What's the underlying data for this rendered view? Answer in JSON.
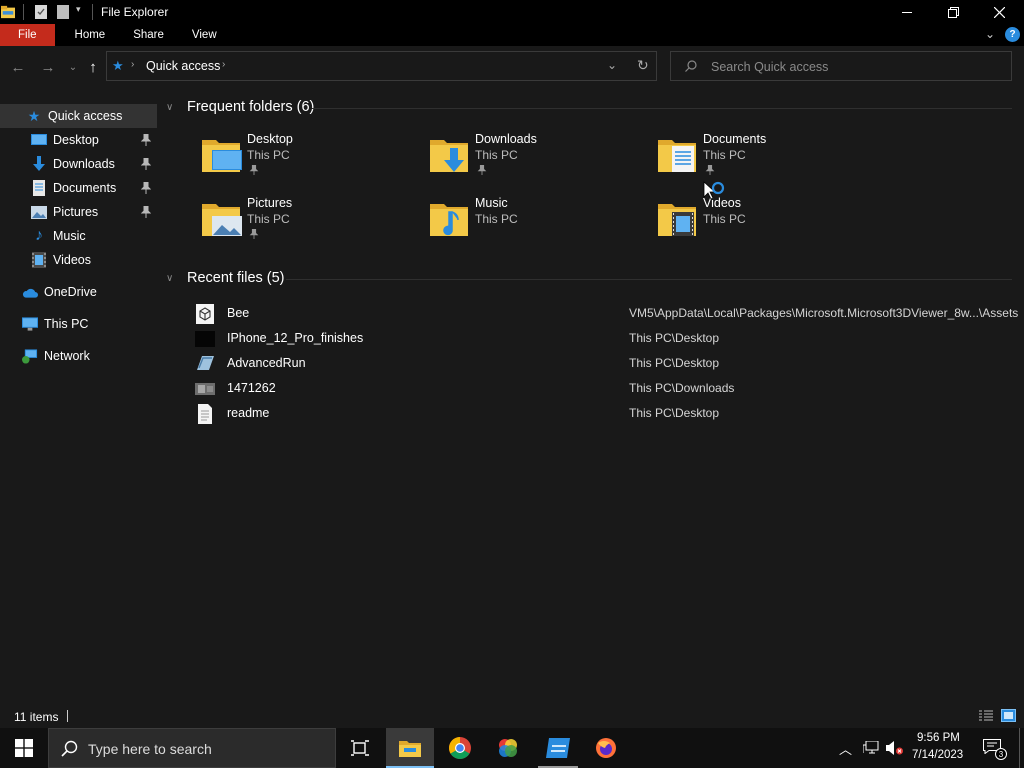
{
  "window": {
    "title": "File Explorer"
  },
  "ribbon": {
    "tabs": [
      "File",
      "Home",
      "Share",
      "View"
    ]
  },
  "address": {
    "location": "Quick access",
    "search_placeholder": "Search Quick access"
  },
  "sidebar": {
    "items": [
      {
        "label": "Quick access",
        "icon": "star-icon"
      },
      {
        "label": "Desktop",
        "icon": "desktop-icon",
        "pinned": true
      },
      {
        "label": "Downloads",
        "icon": "download-icon",
        "pinned": true
      },
      {
        "label": "Documents",
        "icon": "document-icon",
        "pinned": true
      },
      {
        "label": "Pictures",
        "icon": "picture-icon",
        "pinned": true
      },
      {
        "label": "Music",
        "icon": "music-icon"
      },
      {
        "label": "Videos",
        "icon": "video-icon"
      },
      {
        "label": "OneDrive",
        "icon": "cloud-icon"
      },
      {
        "label": "This PC",
        "icon": "computer-icon"
      },
      {
        "label": "Network",
        "icon": "network-icon"
      }
    ]
  },
  "frequent": {
    "header": "Frequent folders (6)",
    "folders": [
      {
        "name": "Desktop",
        "location": "This PC",
        "pinned": true,
        "icon": "desktop-folder-icon"
      },
      {
        "name": "Downloads",
        "location": "This PC",
        "pinned": true,
        "icon": "downloads-folder-icon"
      },
      {
        "name": "Documents",
        "location": "This PC",
        "pinned": true,
        "icon": "documents-folder-icon"
      },
      {
        "name": "Pictures",
        "location": "This PC",
        "pinned": true,
        "icon": "pictures-folder-icon"
      },
      {
        "name": "Music",
        "location": "This PC",
        "pinned": false,
        "icon": "music-folder-icon"
      },
      {
        "name": "Videos",
        "location": "This PC",
        "pinned": false,
        "icon": "videos-folder-icon"
      }
    ]
  },
  "recent": {
    "header": "Recent files (5)",
    "files": [
      {
        "name": "Bee",
        "path": "VM5\\AppData\\Local\\Packages\\Microsoft.Microsoft3DViewer_8w...\\Assets",
        "icon": "3d-object-icon"
      },
      {
        "name": "IPhone_12_Pro_finishes",
        "path": "This PC\\Desktop",
        "icon": "image-thumbnail-icon"
      },
      {
        "name": "AdvancedRun",
        "path": "This PC\\Desktop",
        "icon": "application-icon"
      },
      {
        "name": "1471262",
        "path": "This PC\\Downloads",
        "icon": "image-thumbnail-icon"
      },
      {
        "name": "readme",
        "path": "This PC\\Desktop",
        "icon": "text-file-icon"
      }
    ]
  },
  "status": {
    "item_count": "11 items"
  },
  "taskbar": {
    "search_placeholder": "Type here to search",
    "time": "9:56 PM",
    "date": "7/14/2023",
    "notification_count": "3"
  },
  "colors": {
    "accent": "#c42b1c",
    "background": "#191919",
    "folder_yellow": "#f3c948",
    "link_blue": "#2a8cde"
  }
}
